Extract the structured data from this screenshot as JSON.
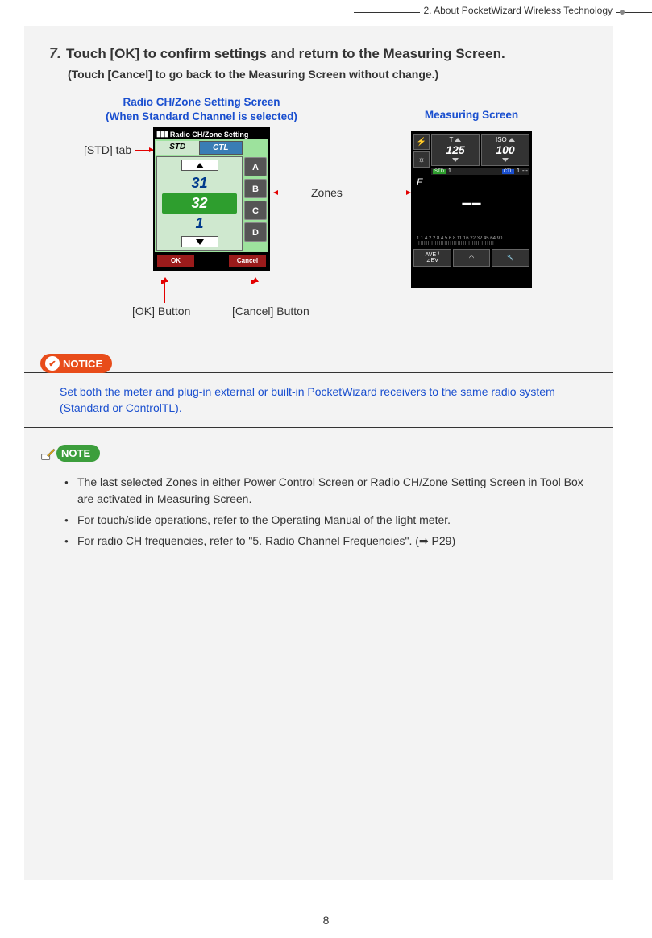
{
  "header": {
    "chapter": "2.  About PocketWizard Wireless Technology"
  },
  "step": {
    "num": "7.",
    "title": "Touch [OK] to confirm settings and return to the Measuring Screen.",
    "subtitle": "(Touch [Cancel] to go back to the Measuring Screen without change.)"
  },
  "diagram": {
    "caption_left_l1": "Radio CH/Zone Setting Screen",
    "caption_left_l2": "(When Standard Channel is selected)",
    "caption_right": "Measuring Screen",
    "callout_std": "[STD] tab",
    "callout_zones": "Zones",
    "callout_ok": "[OK] Button",
    "callout_cancel": "[Cancel] Button"
  },
  "device_left": {
    "title": "Radio CH/Zone Setting",
    "tab_std": "STD",
    "tab_ctl": "CTL",
    "num_prev": "31",
    "num_sel": "32",
    "num_next": "1",
    "zones": [
      "A",
      "B",
      "C",
      "D"
    ],
    "ok": "OK",
    "cancel": "Cancel"
  },
  "device_right": {
    "t_label": "T",
    "t_value": "125",
    "iso_label": "ISO",
    "iso_value": "100",
    "std": "STD",
    "std_num": "1",
    "ctl": "CTL",
    "ctl_num": "1",
    "ctl_dash": "---",
    "f_label": "F",
    "f_value": "––",
    "scale": "1  1.4  2  2.8  4  5.6  8  11 16 22 32 45 64 90",
    "ave": "AVE /",
    "ev": "⊿EV"
  },
  "notice": {
    "label": "NOTICE",
    "text": "Set both the meter and plug-in external or built-in PocketWizard receivers to the same radio system (Standard or ControlTL)."
  },
  "note": {
    "label": "NOTE",
    "items": [
      "The last selected Zones in either Power Control Screen or Radio CH/Zone Setting Screen in Tool Box are activated in Measuring Screen.",
      "For touch/slide operations, refer to the Operating Manual of the light meter.",
      "For radio CH frequencies, refer to \"5. Radio Channel Frequencies\". (➡ P29)"
    ]
  },
  "page_number": "8"
}
